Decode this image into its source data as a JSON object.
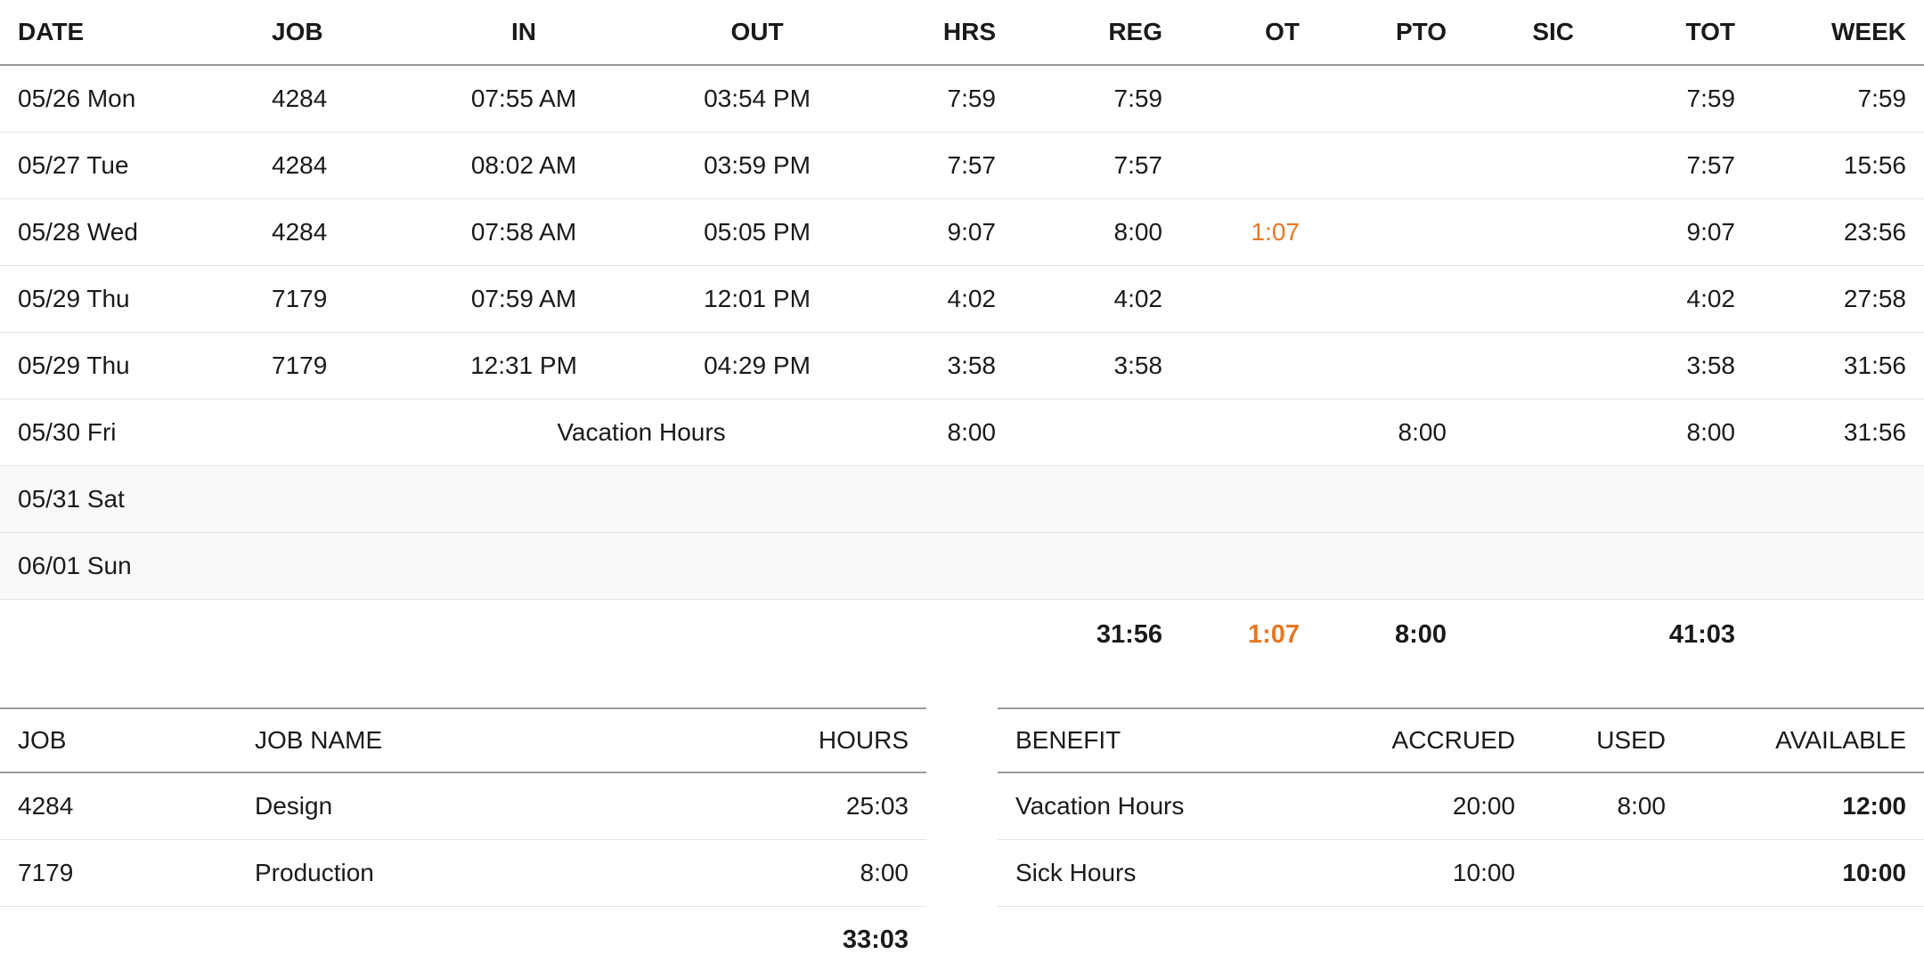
{
  "timesheet": {
    "headers": {
      "date": "DATE",
      "job": "JOB",
      "in": "IN",
      "out": "OUT",
      "hrs": "HRS",
      "reg": "REG",
      "ot": "OT",
      "pto": "PTO",
      "sic": "SIC",
      "tot": "TOT",
      "week": "WEEK"
    },
    "rows": [
      {
        "date": "05/26 Mon",
        "job": "4284",
        "in": "07:55 AM",
        "out": "03:54 PM",
        "hrs": "7:59",
        "reg": "7:59",
        "ot": "",
        "pto": "",
        "sic": "",
        "tot": "7:59",
        "week": "7:59"
      },
      {
        "date": "05/27 Tue",
        "job": "4284",
        "in": "08:02 AM",
        "out": "03:59 PM",
        "hrs": "7:57",
        "reg": "7:57",
        "ot": "",
        "pto": "",
        "sic": "",
        "tot": "7:57",
        "week": "15:56"
      },
      {
        "date": "05/28 Wed",
        "job": "4284",
        "in": "07:58 AM",
        "out": "05:05 PM",
        "hrs": "9:07",
        "reg": "8:00",
        "ot": "1:07",
        "pto": "",
        "sic": "",
        "tot": "9:07",
        "week": "23:56"
      },
      {
        "date": "05/29 Thu",
        "job": "7179",
        "in": "07:59 AM",
        "out": "12:01 PM",
        "hrs": "4:02",
        "reg": "4:02",
        "ot": "",
        "pto": "",
        "sic": "",
        "tot": "4:02",
        "week": "27:58"
      },
      {
        "date": "05/29 Thu",
        "job": "7179",
        "in": "12:31 PM",
        "out": "04:29 PM",
        "hrs": "3:58",
        "reg": "3:58",
        "ot": "",
        "pto": "",
        "sic": "",
        "tot": "3:58",
        "week": "31:56"
      },
      {
        "date": "05/30 Fri",
        "vacation_label": "Vacation Hours",
        "hrs": "8:00",
        "reg": "",
        "ot": "",
        "pto": "8:00",
        "sic": "",
        "tot": "8:00",
        "week": "31:56"
      },
      {
        "date": "05/31 Sat"
      },
      {
        "date": "06/01 Sun"
      }
    ],
    "totals": {
      "reg": "31:56",
      "ot": "1:07",
      "pto": "8:00",
      "tot": "41:03"
    }
  },
  "jobs": {
    "headers": {
      "job": "JOB",
      "name": "JOB NAME",
      "hours": "HOURS"
    },
    "rows": [
      {
        "job": "4284",
        "name": "Design",
        "hours": "25:03"
      },
      {
        "job": "7179",
        "name": "Production",
        "hours": "8:00"
      }
    ],
    "total": "33:03"
  },
  "benefits": {
    "headers": {
      "benefit": "BENEFIT",
      "accrued": "ACCRUED",
      "used": "USED",
      "available": "AVAILABLE"
    },
    "rows": [
      {
        "benefit": "Vacation Hours",
        "accrued": "20:00",
        "used": "8:00",
        "available": "12:00"
      },
      {
        "benefit": "Sick Hours",
        "accrued": "10:00",
        "used": "",
        "available": "10:00"
      }
    ]
  },
  "colors": {
    "overtime_accent": "#e87722",
    "header_border": "#9a9a9a",
    "row_border": "#e3e3e3",
    "weekend_bg": "#f8f9fb"
  }
}
